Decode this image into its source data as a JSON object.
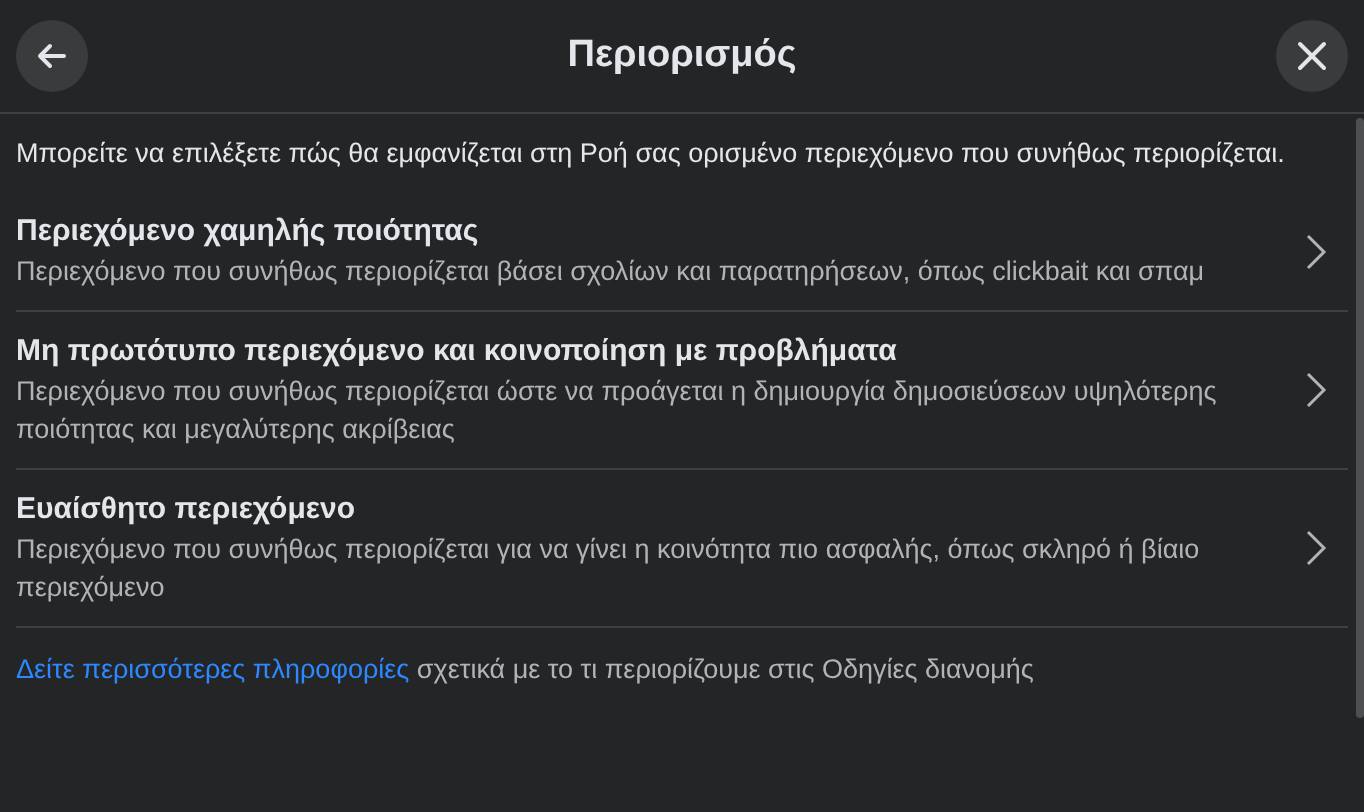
{
  "header": {
    "title": "Περιορισμός"
  },
  "intro": "Μπορείτε να επιλέξετε πώς θα εμφανίζεται στη Ροή σας ορισμένο περιεχόμενο που συνήθως περιορίζεται.",
  "options": [
    {
      "title": "Περιεχόμενο χαμηλής ποιότητας",
      "description": "Περιεχόμενο που συνήθως περιορίζεται βάσει σχολίων και παρατηρήσεων, όπως clickbait και σπαμ"
    },
    {
      "title": "Μη πρωτότυπο περιεχόμενο και κοινοποίηση με προβλήματα",
      "description": "Περιεχόμενο που συνήθως περιορίζεται ώστε να προάγεται η δημιουργία δημοσιεύσεων υψηλότερης ποιότητας και μεγαλύτερης ακρίβειας"
    },
    {
      "title": "Ευαίσθητο περιεχόμενο",
      "description": "Περιεχόμενο που συνήθως περιορίζεται για να γίνει η κοινότητα πιο ασφαλής, όπως σκληρό ή βίαιο περιεχόμενο"
    }
  ],
  "footer": {
    "link": "Δείτε περισσότερες πληροφορίες",
    "text": "σχετικά με το τι περιορίζουμε στις Οδηγίες διανομής"
  }
}
